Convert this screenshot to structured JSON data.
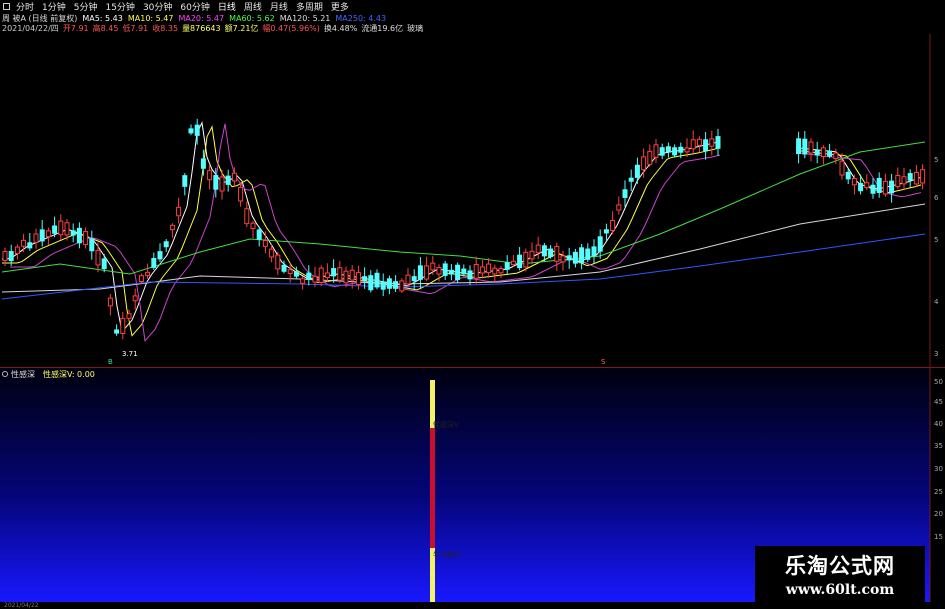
{
  "toolbar": {
    "items": [
      "分时",
      "1分钟",
      "5分钟",
      "15分钟",
      "30分钟",
      "60分钟",
      "日线",
      "周线",
      "月线",
      "多周期",
      "更多"
    ],
    "active_index": 6
  },
  "ma_bar": {
    "stock": "周 被A (日线 前复权)",
    "ma5": "MA5: 5.43",
    "ma10": "MA10: 5.47",
    "ma20": "MA20: 5.47",
    "ma60": "MA60: 5.62",
    "ma120": "MA120: 5.21",
    "ma250": "MA250: 4.43",
    "colors": {
      "ma5": "#ffffff",
      "ma10": "#ffff44",
      "ma20": "#ff44ff",
      "ma60": "#44ff44",
      "ma120": "#dddddd",
      "ma250": "#4466ff"
    }
  },
  "info_bar": {
    "date": "2021/04/22/四",
    "open": "开7.91",
    "high": "高8.45",
    "low": "低7.91",
    "close": "收8.35",
    "volume": "量876643",
    "amount": "额7.21亿",
    "change": "幅0.47(5.96%)",
    "turnover": "换4.48%",
    "float_cap": "流通19.6亿",
    "note": "玻璃"
  },
  "price_chart": {
    "low_marker_label": "3.71",
    "marker_a": "B",
    "marker_b": "S",
    "right_axis_labels": [
      "5",
      "6",
      "5",
      "4",
      "3"
    ]
  },
  "indicator": {
    "name": "性感深",
    "value_label": "性感深V: 0.00",
    "bar_label_top": "性感深V",
    "bar_label_bottom": "牛气制作",
    "yaxis": [
      "50",
      "45",
      "40",
      "35",
      "30",
      "25",
      "20",
      "15"
    ]
  },
  "watermark": {
    "line1": "乐淘公式网",
    "line2": "www.60lt.com"
  },
  "bottom": {
    "date": "2021/04/22"
  }
}
